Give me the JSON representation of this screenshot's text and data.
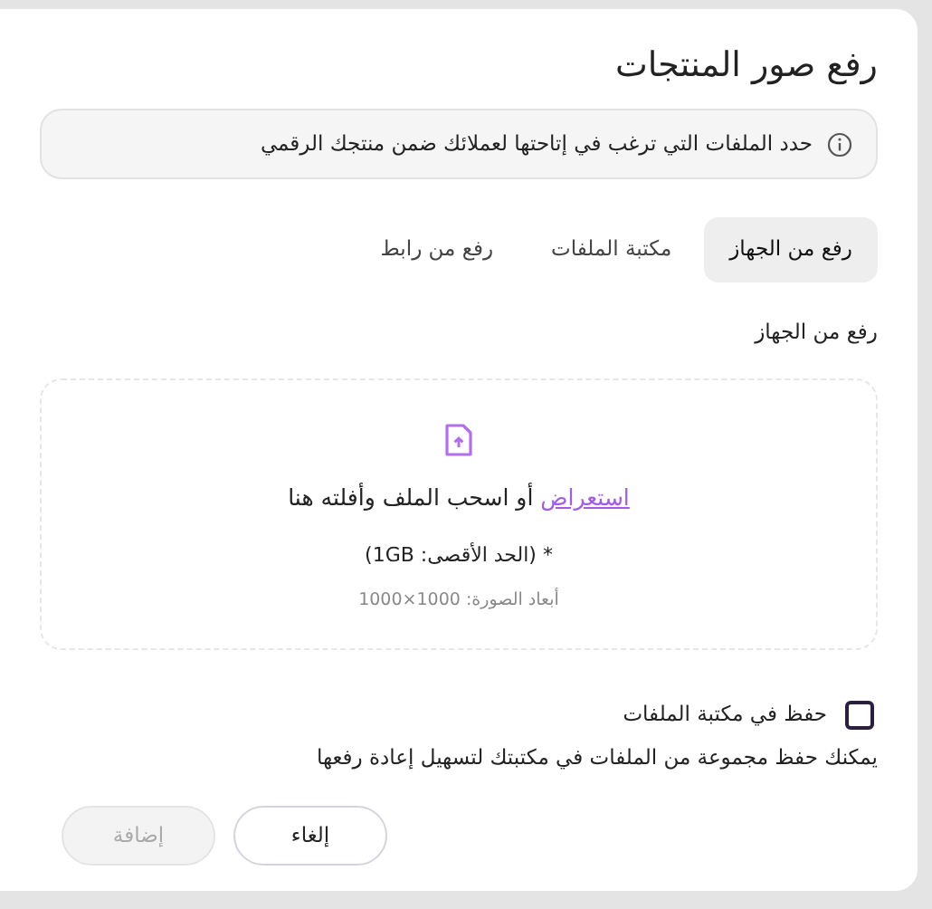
{
  "dialog": {
    "title": "رفع صور المنتجات"
  },
  "info": {
    "text": "حدد الملفات التي ترغب في إتاحتها لعملائك ضمن منتجك الرقمي"
  },
  "tabs": [
    {
      "label": "رفع من الجهاز",
      "selected": true
    },
    {
      "label": "مكتبة الملفات",
      "selected": false
    },
    {
      "label": "رفع من رابط",
      "selected": false
    }
  ],
  "section_label": "رفع من الجهاز",
  "dropzone": {
    "browse_link": "استعراض",
    "prompt": "أو اسحب الملف وأفلته هنا",
    "max_size": "* (الحد الأقصى: 1GB)",
    "dimensions": "أبعاد الصورة: 1000×1000"
  },
  "save_option": {
    "label": "حفظ في مكتبة الملفات",
    "checked": false,
    "hint": "يمكنك حفظ مجموعة من الملفات في مكتبتك لتسهيل إعادة رفعها"
  },
  "buttons": [
    {
      "label": "إلغاء",
      "disabled": false
    },
    {
      "label": "إضافة",
      "disabled": true
    }
  ]
}
